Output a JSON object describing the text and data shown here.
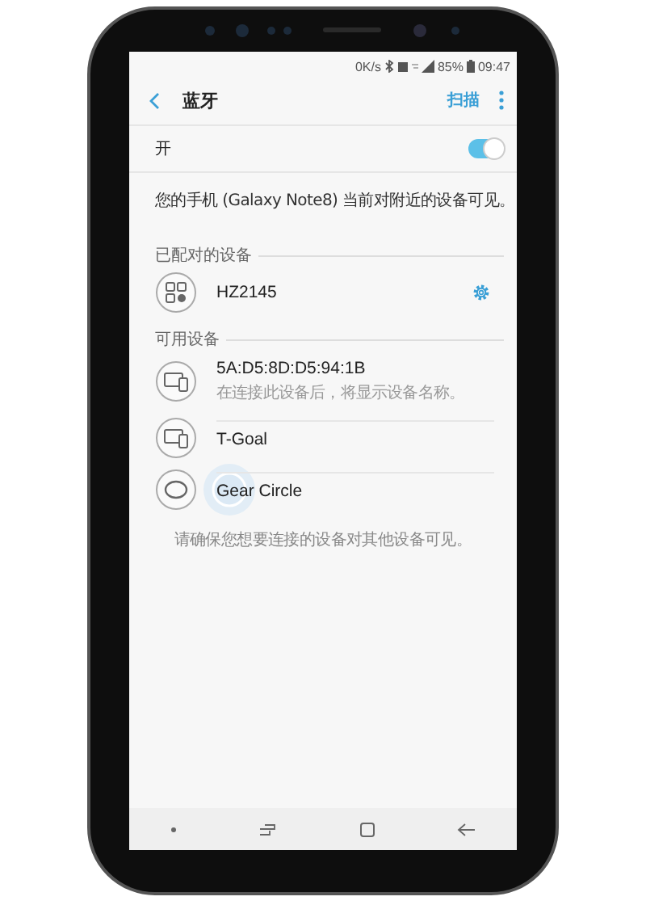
{
  "status_bar": {
    "speed": "0K/s",
    "battery": "85%",
    "time": "09:47"
  },
  "header": {
    "title": "蓝牙",
    "action": "扫描"
  },
  "toggle": {
    "label": "开",
    "on": true
  },
  "visibility_note": "您的手机 (Galaxy Note8) 当前对附近的设备可见。",
  "sections": [
    {
      "title": "已配对的设备",
      "devices": [
        {
          "kind": "paired",
          "name": "HZ2145",
          "pressed": false
        }
      ]
    },
    {
      "title": "可用设备",
      "devices": [
        {
          "kind": "phone",
          "name": "5A:D5:8D:D5:94:1B",
          "subtitle": "在连接此设备后，将显示设备名称。",
          "pressed": false
        },
        {
          "kind": "phone",
          "name": "T-Goal",
          "pressed": false
        },
        {
          "kind": "watch",
          "name": "Gear Circle",
          "pressed": true
        }
      ]
    }
  ],
  "footer_note": "请确保您想要连接的设备对其他设备可见。"
}
